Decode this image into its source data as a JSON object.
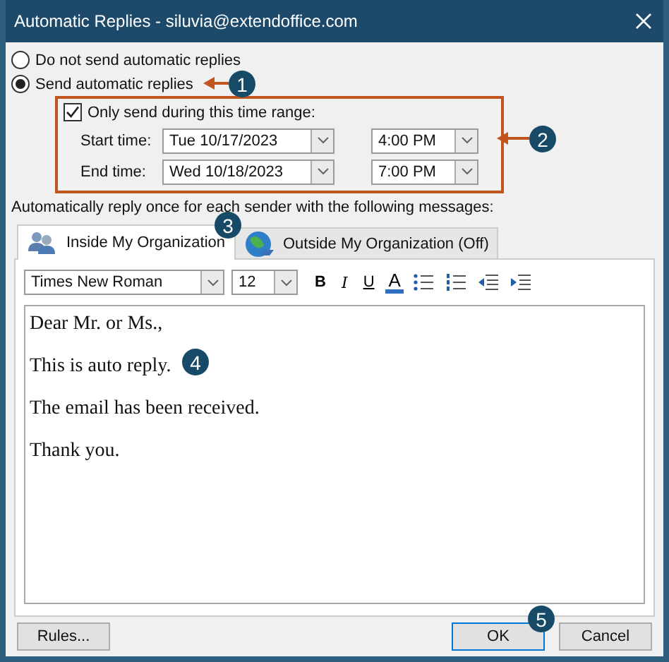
{
  "window": {
    "title": "Automatic Replies - siluvia@extendoffice.com"
  },
  "radios": [
    {
      "label": "Do not send automatic replies",
      "selected": false
    },
    {
      "label": "Send automatic replies",
      "selected": true
    }
  ],
  "time_range": {
    "label": "Only send during this time range:",
    "checked": true,
    "rows": [
      {
        "label": "Start time:",
        "date": "Tue 10/17/2023",
        "time": "4:00 PM"
      },
      {
        "label": "End time:",
        "date": "Wed 10/18/2023",
        "time": "7:00 PM"
      }
    ]
  },
  "instruction": "Automatically reply once for each sender with the following messages:",
  "tabs": [
    {
      "label": "Inside My Organization",
      "selected": true,
      "kind": "people"
    },
    {
      "label": "Outside My Organization (Off)",
      "selected": false,
      "kind": "globe"
    }
  ],
  "toolbar": {
    "font": "Times New Roman",
    "size": "12",
    "buttons": [
      {
        "kind": "bold",
        "text": "B"
      },
      {
        "kind": "italic",
        "text": "I"
      },
      {
        "kind": "underline",
        "text": "U"
      },
      {
        "kind": "color",
        "text": "A"
      },
      {
        "kind": "bullets"
      },
      {
        "kind": "numbers"
      },
      {
        "kind": "outdent"
      },
      {
        "kind": "indent"
      }
    ]
  },
  "message": [
    "Dear Mr. or Ms.,",
    "This is auto reply.",
    "The email has been received.",
    "Thank you."
  ],
  "buttons": [
    {
      "label": "Rules...",
      "kind": "rules"
    },
    {
      "label": "OK",
      "kind": "default"
    },
    {
      "label": "Cancel",
      "kind": "cancel"
    }
  ],
  "callouts": [
    {
      "number": "1",
      "arrow": true
    },
    {
      "number": "2",
      "arrow": true
    },
    {
      "number": "3",
      "arrow": false
    },
    {
      "number": "4",
      "arrow": false
    },
    {
      "number": "5",
      "arrow": false
    }
  ]
}
